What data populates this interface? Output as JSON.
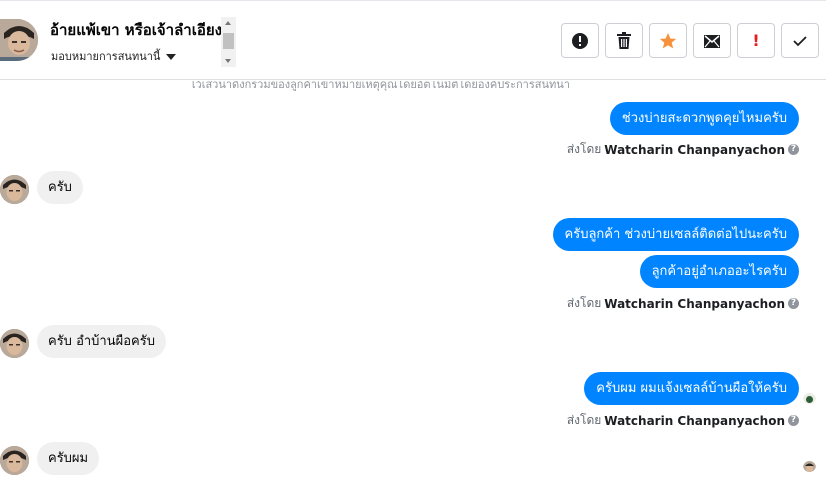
{
  "header": {
    "contact_name": "อ้ายแพ้เขา หรือเจ้าลำเอียง",
    "assign_label": "มอบหมายการสนทนานี้",
    "actions": [
      "mark-spam-icon",
      "delete-icon",
      "star-icon",
      "mark-unread-icon",
      "important-icon",
      "done-icon"
    ],
    "important_label": "!"
  },
  "thread": {
    "cut_note": "ไว้เสวนาดังกรวมของลูกค้าเข้าหมายเหตุคุณโดยอัตโนมัติโดยองค์ประการสนทนา",
    "messages": [
      {
        "from": "page",
        "text": "ช่วงบ่ายสะดวกพูดคุยไหมครับ"
      },
      {
        "from": "customer",
        "text": "ครับ"
      },
      {
        "from": "page",
        "text": "ครับลูกค้า ช่วงบ่ายเซลล์ติดต่อไปนะครับ"
      },
      {
        "from": "page",
        "text": "ลูกค้าอยู่อำเภออะไรครับ"
      },
      {
        "from": "customer",
        "text": "ครับ อำบ้านผือครับ"
      },
      {
        "from": "page",
        "text": "ครับผม ผมแจ้งเซลล์บ้านผือให้ครับ"
      },
      {
        "from": "customer",
        "text": "ครับผม"
      }
    ],
    "sent_by_prefix": "ส่งโดย",
    "sent_by_name": "Watcharin Chanpanyachon",
    "info_glyph": "?"
  },
  "colors": {
    "outgoing": "#0084ff",
    "incoming": "#f0f0f0",
    "star": "#f7923a",
    "important": "#e41e1e"
  }
}
